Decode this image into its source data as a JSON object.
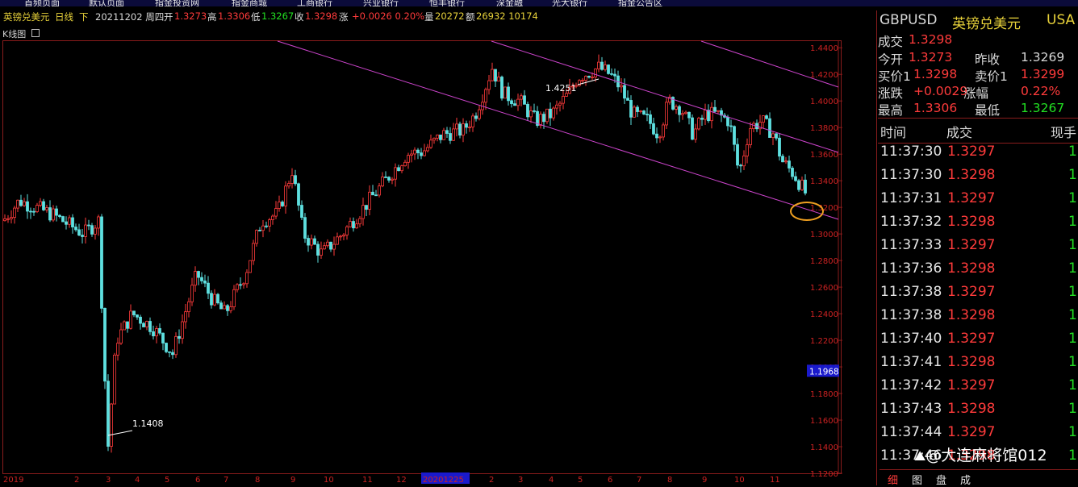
{
  "topbar": {
    "tabs": [
      "首频页面",
      "默认页面",
      "指金投资网",
      "指金商城",
      "工商银行",
      "兴业银行",
      "恒丰银行",
      "深金融",
      "光大银行",
      "指金公告区"
    ]
  },
  "infobar": {
    "name": "英镑兑美元",
    "period": "日线",
    "adj": "下",
    "date_text": "20211202 周四",
    "open_lbl": "开",
    "open": "1.3273",
    "high_lbl": "高",
    "high": "1.3306",
    "low_lbl": "低",
    "low": "1.3267",
    "close_lbl": "收",
    "close": "1.3298",
    "chg_lbl": "涨",
    "chg": "+0.0026 0.20%",
    "vol_lbl": "量",
    "vol": "20272",
    "amt_lbl": "额",
    "amt": "26932 10174"
  },
  "panel": {
    "title": "K线图"
  },
  "chart_data": {
    "type": "candlestick",
    "y_ticks": [
      "1.4400",
      "1.4200",
      "1.4000",
      "1.3800",
      "1.3600",
      "1.3400",
      "1.3200",
      "1.3000",
      "1.2800",
      "1.2600",
      "1.2400",
      "1.2200",
      "1.2000",
      "1.1800",
      "1.1600",
      "1.1400",
      "1.1200"
    ],
    "current_price_tag": "1.1968",
    "annotations": [
      "1.4251",
      "1.1408"
    ],
    "x_labels": [
      "2019",
      "2",
      "3",
      "4",
      "5",
      "6",
      "7",
      "8",
      "9",
      "10",
      "11",
      "12",
      "20201225",
      "2",
      "3",
      "4",
      "5",
      "6",
      "7",
      "8",
      "9",
      "10",
      "11"
    ],
    "ylim": [
      1.12,
      1.445
    ],
    "colors": {
      "up": "#ff3b3b",
      "down": "#5ee0e0",
      "channel": "#cc44cc",
      "circle": "#f0a020"
    }
  },
  "quote": {
    "symbol": "GBPUSD",
    "cname": "英镑兑美元",
    "market": "USA",
    "last_lbl": "成交",
    "last": "1.3298",
    "open_lbl": "今开",
    "open": "1.3273",
    "prev_lbl": "昨收",
    "prev": "1.3269",
    "bid_lbl": "买价1",
    "bid": "1.3298",
    "ask_lbl": "卖价1",
    "ask": "1.3299",
    "chg_lbl": "涨跌",
    "chg": "+0.0029",
    "pct_lbl": "涨幅",
    "pct": "0.22%",
    "high_lbl": "最高",
    "high": "1.3306",
    "low_lbl": "最低",
    "low": "1.3267"
  },
  "trades_header": {
    "time": "时间",
    "price": "成交",
    "volume": "现手"
  },
  "trades": [
    {
      "time": "11:37:30",
      "price": "1.3297",
      "vol": "1"
    },
    {
      "time": "11:37:30",
      "price": "1.3298",
      "vol": "1"
    },
    {
      "time": "11:37:31",
      "price": "1.3297",
      "vol": "1"
    },
    {
      "time": "11:37:32",
      "price": "1.3298",
      "vol": "1"
    },
    {
      "time": "11:37:33",
      "price": "1.3297",
      "vol": "1"
    },
    {
      "time": "11:37:36",
      "price": "1.3298",
      "vol": "1"
    },
    {
      "time": "11:37:38",
      "price": "1.3297",
      "vol": "1"
    },
    {
      "time": "11:37:38",
      "price": "1.3298",
      "vol": "1"
    },
    {
      "time": "11:37:40",
      "price": "1.3297",
      "vol": "1"
    },
    {
      "time": "11:37:41",
      "price": "1.3298",
      "vol": "1"
    },
    {
      "time": "11:37:42",
      "price": "1.3297",
      "vol": "1"
    },
    {
      "time": "11:37:43",
      "price": "1.3298",
      "vol": "1"
    },
    {
      "time": "11:37:44",
      "price": "1.3297",
      "vol": "1"
    },
    {
      "time": "11:37:46",
      "price": "1.3298",
      "vol": "1"
    }
  ],
  "watermark": "@大连麻将馆012",
  "bottom_tabs": [
    "细",
    "图",
    "盘",
    "成"
  ]
}
